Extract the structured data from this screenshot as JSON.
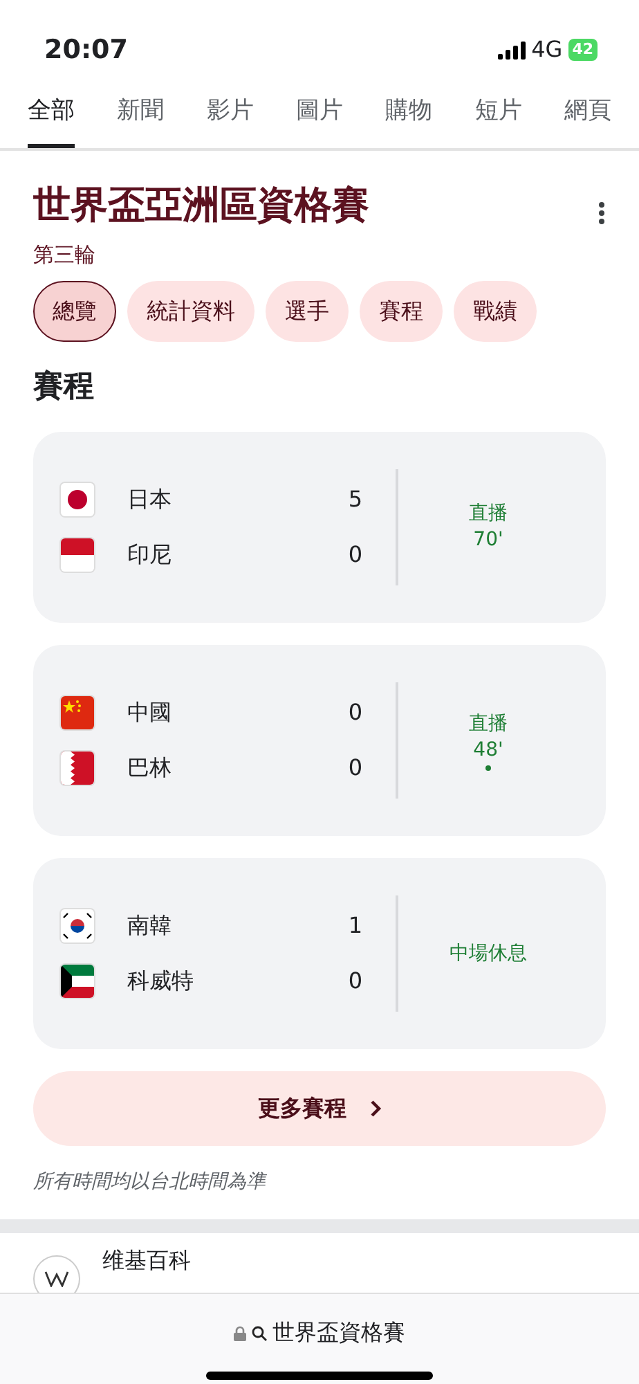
{
  "status_bar": {
    "time": "20:07",
    "network": "4G",
    "battery": "42"
  },
  "tabs": [
    {
      "label": "全部",
      "selected": true
    },
    {
      "label": "新聞",
      "selected": false
    },
    {
      "label": "影片",
      "selected": false
    },
    {
      "label": "圖片",
      "selected": false
    },
    {
      "label": "購物",
      "selected": false
    },
    {
      "label": "短片",
      "selected": false
    },
    {
      "label": "網頁",
      "selected": false
    }
  ],
  "header": {
    "title": "世界盃亞洲區資格賽",
    "subtitle": "第三輪"
  },
  "chips": [
    {
      "label": "總覽",
      "selected": true
    },
    {
      "label": "統計資料",
      "selected": false
    },
    {
      "label": "選手",
      "selected": false
    },
    {
      "label": "賽程",
      "selected": false
    },
    {
      "label": "戰績",
      "selected": false
    }
  ],
  "section_title": "賽程",
  "matches": [
    {
      "teams": [
        {
          "name": "日本",
          "score": "5",
          "kind": "jp"
        },
        {
          "name": "印尼",
          "score": "0",
          "kind": "id"
        }
      ],
      "status": "直播",
      "minute": "70'",
      "live_dot": false
    },
    {
      "teams": [
        {
          "name": "中國",
          "score": "0",
          "kind": "cn"
        },
        {
          "name": "巴林",
          "score": "0",
          "kind": "bh"
        }
      ],
      "status": "直播",
      "minute": "48'",
      "live_dot": true
    },
    {
      "teams": [
        {
          "name": "南韓",
          "score": "1",
          "kind": "kr"
        },
        {
          "name": "科威特",
          "score": "0",
          "kind": "kw"
        }
      ],
      "status": "中場休息",
      "live_dot": false
    }
  ],
  "more_button": "更多賽程",
  "note": "所有時間均以台北時間為準",
  "result": {
    "source": "维基百科"
  },
  "address_bar": {
    "query": "世界盃資格賽"
  }
}
